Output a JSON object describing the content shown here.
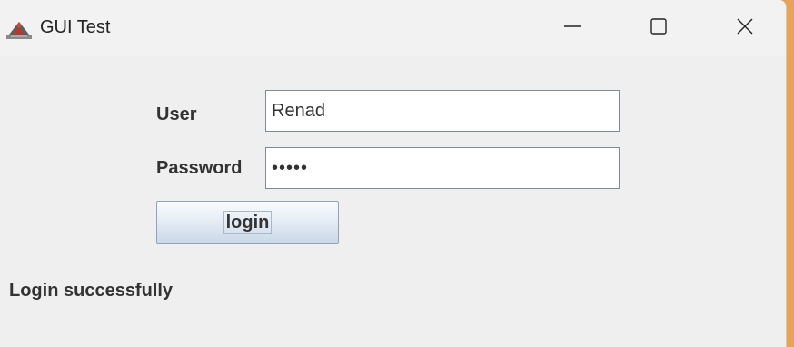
{
  "window": {
    "title": "GUI Test",
    "icons": {
      "app": "java-duke-app-icon",
      "minimize": "minimize-icon",
      "maximize": "maximize-icon",
      "close": "close-icon"
    }
  },
  "form": {
    "user_label": "User",
    "user_value": "Renad",
    "password_label": "Password",
    "password_value": "•••••",
    "login_label": "login"
  },
  "status": {
    "message": "Login successfully"
  },
  "colors": {
    "window_bg": "#efefef",
    "button_gradient_top": "#fbfcfd",
    "button_gradient_bottom": "#c9d7e7",
    "input_border": "#7f8a96"
  }
}
